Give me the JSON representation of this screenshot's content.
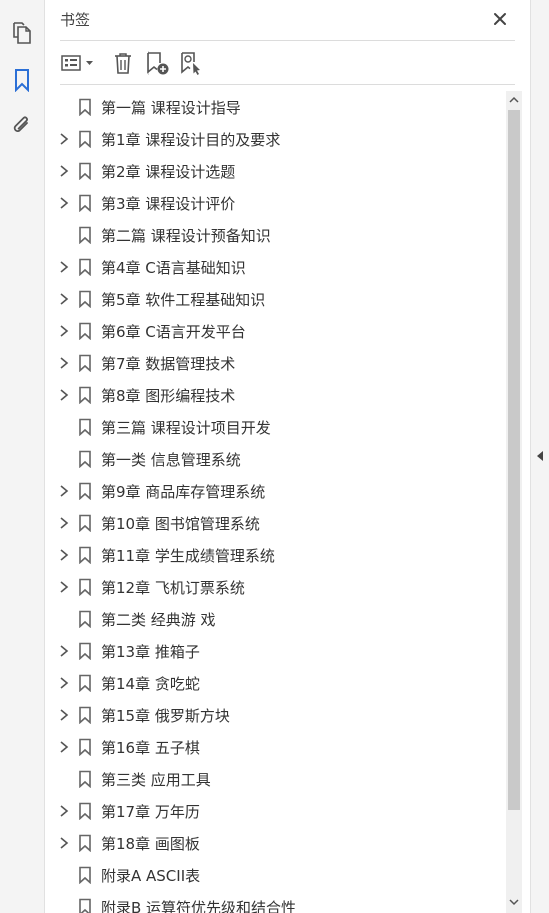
{
  "left_rail": {
    "icons": [
      "pages-icon",
      "bookmark-icon",
      "attachment-icon"
    ],
    "active": "bookmark-icon",
    "accent": "#2b6fd6"
  },
  "panel": {
    "title": "书签"
  },
  "toolbar": {
    "icons": [
      "options-menu-icon",
      "delete-icon",
      "new-bookmark-icon",
      "bookmark-from-selection-icon"
    ]
  },
  "bookmarks": [
    {
      "label": "第一篇 课程设计指导",
      "expandable": false
    },
    {
      "label": "第1章 课程设计目的及要求",
      "expandable": true
    },
    {
      "label": "第2章 课程设计选题",
      "expandable": true
    },
    {
      "label": "第3章 课程设计评价",
      "expandable": true
    },
    {
      "label": "第二篇 课程设计预备知识",
      "expandable": false
    },
    {
      "label": "第4章 C语言基础知识",
      "expandable": true
    },
    {
      "label": "第5章 软件工程基础知识",
      "expandable": true
    },
    {
      "label": "第6章 C语言开发平台",
      "expandable": true
    },
    {
      "label": "第7章 数据管理技术",
      "expandable": true
    },
    {
      "label": "第8章 图形编程技术",
      "expandable": true
    },
    {
      "label": "第三篇 课程设计项目开发",
      "expandable": false
    },
    {
      "label": "第一类 信息管理系统",
      "expandable": false
    },
    {
      "label": "第9章 商品库存管理系统",
      "expandable": true
    },
    {
      "label": "第10章 图书馆管理系统",
      "expandable": true
    },
    {
      "label": "第11章 学生成绩管理系统",
      "expandable": true
    },
    {
      "label": "第12章 飞机订票系统",
      "expandable": true
    },
    {
      "label": "第二类 经典游 戏",
      "expandable": false
    },
    {
      "label": "第13章 推箱子",
      "expandable": true
    },
    {
      "label": "第14章 贪吃蛇",
      "expandable": true
    },
    {
      "label": "第15章 俄罗斯方块",
      "expandable": true
    },
    {
      "label": "第16章 五子棋",
      "expandable": true
    },
    {
      "label": "第三类 应用工具",
      "expandable": false
    },
    {
      "label": "第17章 万年历",
      "expandable": true
    },
    {
      "label": "第18章 画图板",
      "expandable": true
    },
    {
      "label": "附录A ASCII表",
      "expandable": false
    },
    {
      "label": "附录B 运算符优先级和结合性",
      "expandable": false
    }
  ]
}
